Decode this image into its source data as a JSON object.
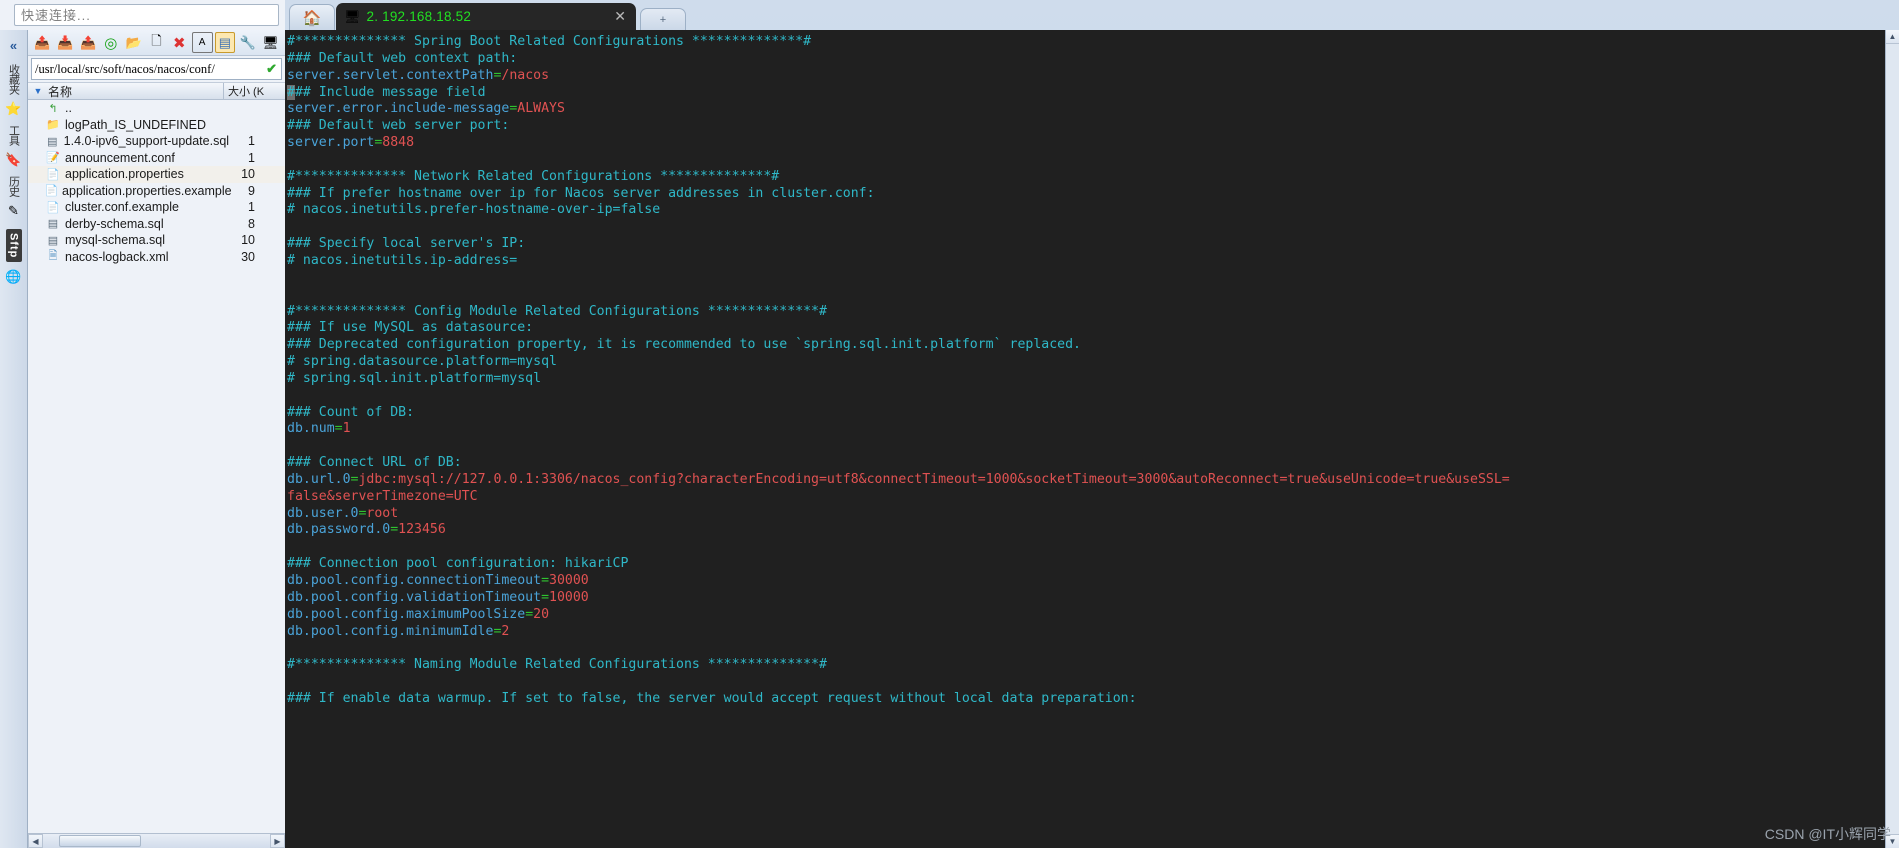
{
  "quick_connect": {
    "placeholder": "快速连接..."
  },
  "left_strip": {
    "collapse_label": "«",
    "vertical_labels": [
      "收藏夹",
      "工具",
      "历史"
    ],
    "sftp_badge": "Sftp"
  },
  "file_toolbar": {
    "buttons": [
      {
        "name": "upload-parent-icon",
        "glyph": "⬆",
        "active": false
      },
      {
        "name": "download-icon",
        "glyph": "⬇",
        "active": false
      },
      {
        "name": "upload-icon",
        "glyph": "⬆",
        "active": false
      },
      {
        "name": "refresh-icon",
        "glyph": "⟳",
        "active": false
      },
      {
        "name": "new-folder-icon",
        "glyph": "🗀",
        "active": false
      },
      {
        "name": "new-file-icon",
        "glyph": "⬜",
        "active": false
      },
      {
        "name": "delete-icon",
        "glyph": "✖",
        "active": false
      },
      {
        "name": "rename-icon",
        "glyph": "Ⓐ",
        "active": false
      },
      {
        "name": "list-view-icon",
        "glyph": "≣",
        "active": true
      },
      {
        "name": "properties-icon",
        "glyph": "🔧",
        "active": false
      },
      {
        "name": "terminal-icon",
        "glyph": "▣",
        "active": false
      }
    ]
  },
  "path_bar": {
    "value": "/usr/local/src/soft/nacos/nacos/conf/",
    "confirm_glyph": "✔"
  },
  "file_columns": {
    "name": "名称",
    "size": "大小 (K"
  },
  "files": [
    {
      "icon": "parent-dir-icon",
      "name": "..",
      "size": ""
    },
    {
      "icon": "folder-icon",
      "name": "logPath_IS_UNDEFINED",
      "size": ""
    },
    {
      "icon": "sql-file-icon",
      "name": "1.4.0-ipv6_support-update.sql",
      "size": "1"
    },
    {
      "icon": "conf-file-icon",
      "name": "announcement.conf",
      "size": "1"
    },
    {
      "icon": "props-file-icon",
      "name": "application.properties",
      "size": "10",
      "selected": true
    },
    {
      "icon": "plain-file-icon",
      "name": "application.properties.example",
      "size": "9"
    },
    {
      "icon": "plain-file-icon",
      "name": "cluster.conf.example",
      "size": "1"
    },
    {
      "icon": "sql-file-icon",
      "name": "derby-schema.sql",
      "size": "8"
    },
    {
      "icon": "sql-file-icon",
      "name": "mysql-schema.sql",
      "size": "10"
    },
    {
      "icon": "xml-file-icon",
      "name": "nacos-logback.xml",
      "size": "30"
    }
  ],
  "tabs": {
    "home_icon": "home-icon",
    "session": {
      "icon": "monitor-icon",
      "label": "2. 192.168.18.52",
      "close_glyph": "✕"
    },
    "add_glyph": "+"
  },
  "terminal": {
    "lines": [
      [
        {
          "t": "#************** Spring Boot Related Configurations **************#",
          "c": "cyan"
        }
      ],
      [
        {
          "t": "### Default web context path:",
          "c": "cyan"
        }
      ],
      [
        {
          "t": "server.servlet.contextPath",
          "c": "blue"
        },
        {
          "t": "=",
          "c": "green"
        },
        {
          "t": "/nacos",
          "c": "red"
        }
      ],
      [
        {
          "t": "#",
          "c": "cursor"
        },
        {
          "t": "## Include message field",
          "c": "cyan"
        }
      ],
      [
        {
          "t": "server.error.include-message",
          "c": "blue"
        },
        {
          "t": "=",
          "c": "green"
        },
        {
          "t": "ALWAYS",
          "c": "red"
        }
      ],
      [
        {
          "t": "### Default web server port:",
          "c": "cyan"
        }
      ],
      [
        {
          "t": "server.port",
          "c": "blue"
        },
        {
          "t": "=",
          "c": "green"
        },
        {
          "t": "8848",
          "c": "red"
        }
      ],
      [
        {
          "t": "",
          "c": "cyan"
        }
      ],
      [
        {
          "t": "#************** Network Related Configurations **************#",
          "c": "cyan"
        }
      ],
      [
        {
          "t": "### If prefer hostname over ip for Nacos server addresses in cluster.conf:",
          "c": "cyan"
        }
      ],
      [
        {
          "t": "# nacos.inetutils.prefer-hostname-over-ip=false",
          "c": "cyan"
        }
      ],
      [
        {
          "t": "",
          "c": "cyan"
        }
      ],
      [
        {
          "t": "### Specify local server's IP:",
          "c": "cyan"
        }
      ],
      [
        {
          "t": "# nacos.inetutils.ip-address=",
          "c": "cyan"
        }
      ],
      [
        {
          "t": "",
          "c": "cyan"
        }
      ],
      [
        {
          "t": "",
          "c": "cyan"
        }
      ],
      [
        {
          "t": "#************** Config Module Related Configurations **************#",
          "c": "cyan"
        }
      ],
      [
        {
          "t": "### If use MySQL as datasource:",
          "c": "cyan"
        }
      ],
      [
        {
          "t": "### Deprecated configuration property, it is recommended to use `spring.sql.init.platform` replaced.",
          "c": "cyan"
        }
      ],
      [
        {
          "t": "# spring.datasource.platform=mysql",
          "c": "cyan"
        }
      ],
      [
        {
          "t": "# spring.sql.init.platform=mysql",
          "c": "cyan"
        }
      ],
      [
        {
          "t": "",
          "c": "cyan"
        }
      ],
      [
        {
          "t": "### Count of DB:",
          "c": "cyan"
        }
      ],
      [
        {
          "t": "db.num",
          "c": "blue"
        },
        {
          "t": "=",
          "c": "green"
        },
        {
          "t": "1",
          "c": "red"
        }
      ],
      [
        {
          "t": "",
          "c": "cyan"
        }
      ],
      [
        {
          "t": "### Connect URL of DB:",
          "c": "cyan"
        }
      ],
      [
        {
          "t": "db.url.0",
          "c": "blue"
        },
        {
          "t": "=",
          "c": "green"
        },
        {
          "t": "jdbc:mysql://127.0.0.1:3306/nacos_config?characterEncoding=utf8&connectTimeout=1000&socketTimeout=3000&autoReconnect=true&useUnicode=true&useSSL=",
          "c": "red"
        }
      ],
      [
        {
          "t": "false&serverTimezone=UTC",
          "c": "red"
        }
      ],
      [
        {
          "t": "db.user.0",
          "c": "blue"
        },
        {
          "t": "=",
          "c": "green"
        },
        {
          "t": "root",
          "c": "red"
        }
      ],
      [
        {
          "t": "db.password.0",
          "c": "blue"
        },
        {
          "t": "=",
          "c": "green"
        },
        {
          "t": "123456",
          "c": "red"
        }
      ],
      [
        {
          "t": "",
          "c": "cyan"
        }
      ],
      [
        {
          "t": "### Connection pool configuration: hikariCP",
          "c": "cyan"
        }
      ],
      [
        {
          "t": "db.pool.config.connectionTimeout",
          "c": "blue"
        },
        {
          "t": "=",
          "c": "green"
        },
        {
          "t": "30000",
          "c": "red"
        }
      ],
      [
        {
          "t": "db.pool.config.validationTimeout",
          "c": "blue"
        },
        {
          "t": "=",
          "c": "green"
        },
        {
          "t": "10000",
          "c": "red"
        }
      ],
      [
        {
          "t": "db.pool.config.maximumPoolSize",
          "c": "blue"
        },
        {
          "t": "=",
          "c": "green"
        },
        {
          "t": "20",
          "c": "red"
        }
      ],
      [
        {
          "t": "db.pool.config.minimumIdle",
          "c": "blue"
        },
        {
          "t": "=",
          "c": "green"
        },
        {
          "t": "2",
          "c": "red"
        }
      ],
      [
        {
          "t": "",
          "c": "cyan"
        }
      ],
      [
        {
          "t": "#************** Naming Module Related Configurations **************#",
          "c": "cyan"
        }
      ],
      [
        {
          "t": "",
          "c": "cyan"
        }
      ],
      [
        {
          "t": "### If enable data warmup. If set to false, the server would accept request without local data preparation:",
          "c": "cyan"
        }
      ]
    ]
  },
  "watermark": "CSDN @IT小辉同学",
  "colors": {
    "terminal_bg": "#202020",
    "cyan": "#2fb8c8",
    "blue": "#4aa3d8",
    "red": "#e05252",
    "green": "#2fc42f",
    "tab_green": "#22e022"
  }
}
